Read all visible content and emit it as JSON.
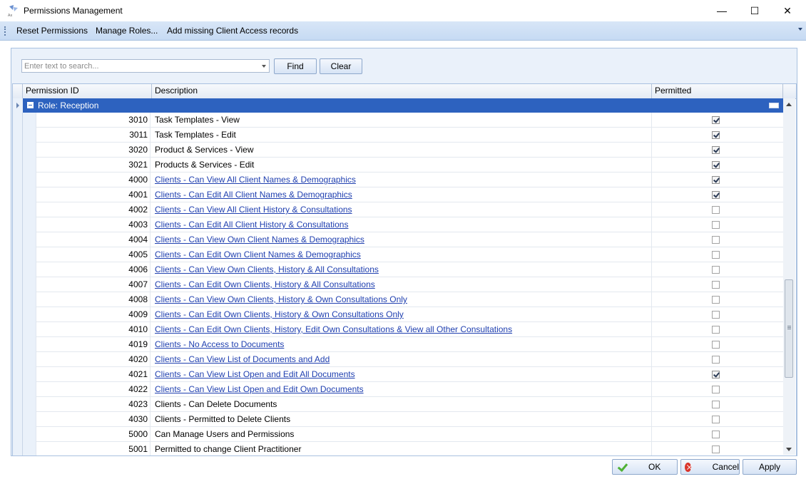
{
  "window": {
    "title": "Permissions Management",
    "minimize_glyph": "—",
    "maximize_glyph": "☐",
    "close_glyph": "✕"
  },
  "menu": {
    "items": [
      "Reset Permissions",
      "Manage Roles...",
      "Add missing Client Access records"
    ]
  },
  "search": {
    "placeholder": "Enter text to search...",
    "find_label": "Find",
    "clear_label": "Clear"
  },
  "grid": {
    "columns": [
      "Permission ID",
      "Description",
      "Permitted"
    ],
    "group_label": "Role: Reception",
    "rows": [
      {
        "id": "3010",
        "description": "Task Templates - View",
        "link": false,
        "permitted": true
      },
      {
        "id": "3011",
        "description": "Task Templates - Edit",
        "link": false,
        "permitted": true
      },
      {
        "id": "3020",
        "description": "Product & Services - View",
        "link": false,
        "permitted": true
      },
      {
        "id": "3021",
        "description": "Products & Services - Edit",
        "link": false,
        "permitted": true
      },
      {
        "id": "4000",
        "description": "Clients - Can View All Client Names & Demographics",
        "link": true,
        "permitted": true
      },
      {
        "id": "4001",
        "description": "Clients - Can Edit All Client Names & Demographics",
        "link": true,
        "permitted": true
      },
      {
        "id": "4002",
        "description": "Clients - Can View All Client History & Consultations",
        "link": true,
        "permitted": false
      },
      {
        "id": "4003",
        "description": "Clients - Can Edit All Client History & Consultations",
        "link": true,
        "permitted": false
      },
      {
        "id": "4004",
        "description": "Clients - Can View Own Client Names & Demographics",
        "link": true,
        "permitted": false
      },
      {
        "id": "4005",
        "description": "Clients - Can Edit Own Client Names & Demographics",
        "link": true,
        "permitted": false
      },
      {
        "id": "4006",
        "description": "Clients - Can View Own Clients, History & All Consultations",
        "link": true,
        "permitted": false
      },
      {
        "id": "4007",
        "description": "Clients - Can Edit Own Clients, History & All Consultations",
        "link": true,
        "permitted": false
      },
      {
        "id": "4008",
        "description": "Clients - Can View Own Clients, History & Own Consultations Only",
        "link": true,
        "permitted": false
      },
      {
        "id": "4009",
        "description": "Clients - Can Edit Own Clients, History & Own Consultations Only",
        "link": true,
        "permitted": false
      },
      {
        "id": "4010",
        "description": "Clients - Can Edit Own Clients, History, Edit Own Consultations & View all Other Consultations",
        "link": true,
        "permitted": false
      },
      {
        "id": "4019",
        "description": "Clients - No Access to Documents",
        "link": true,
        "permitted": false
      },
      {
        "id": "4020",
        "description": "Clients - Can View List of Documents and Add",
        "link": true,
        "permitted": false
      },
      {
        "id": "4021",
        "description": "Clients - Can View List Open and Edit All Documents",
        "link": true,
        "permitted": true
      },
      {
        "id": "4022",
        "description": "Clients - Can View List Open and Edit Own Documents",
        "link": true,
        "permitted": false
      },
      {
        "id": "4023",
        "description": "Clients - Can Delete Documents",
        "link": false,
        "permitted": false
      },
      {
        "id": "4030",
        "description": "Clients - Permitted to Delete Clients",
        "link": false,
        "permitted": false
      },
      {
        "id": "5000",
        "description": "Can Manage Users and Permissions",
        "link": false,
        "permitted": false
      },
      {
        "id": "5001",
        "description": "Permitted to change Client Practitioner",
        "link": false,
        "permitted": false
      }
    ]
  },
  "footer": {
    "ok_label": "OK",
    "cancel_label": "Cancel",
    "apply_label": "Apply"
  }
}
